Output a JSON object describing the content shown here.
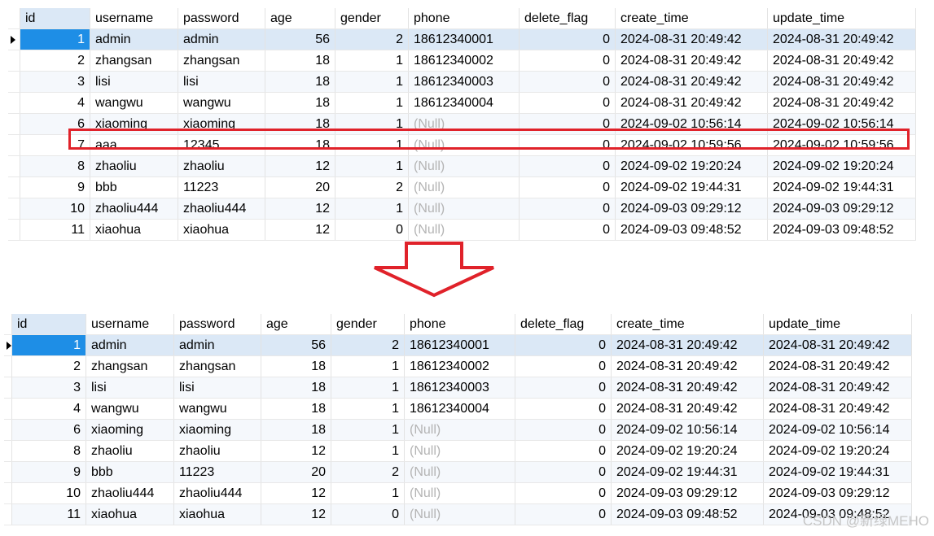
{
  "columns": [
    "id",
    "username",
    "password",
    "age",
    "gender",
    "phone",
    "delete_flag",
    "create_time",
    "update_time"
  ],
  "null_text": "(Null)",
  "before": {
    "rows": [
      [
        "1",
        "admin",
        "admin",
        "56",
        "2",
        "18612340001",
        "0",
        "2024-08-31 20:49:42",
        "2024-08-31 20:49:42"
      ],
      [
        "2",
        "zhangsan",
        "zhangsan",
        "18",
        "1",
        "18612340002",
        "0",
        "2024-08-31 20:49:42",
        "2024-08-31 20:49:42"
      ],
      [
        "3",
        "lisi",
        "lisi",
        "18",
        "1",
        "18612340003",
        "0",
        "2024-08-31 20:49:42",
        "2024-08-31 20:49:42"
      ],
      [
        "4",
        "wangwu",
        "wangwu",
        "18",
        "1",
        "18612340004",
        "0",
        "2024-08-31 20:49:42",
        "2024-08-31 20:49:42"
      ],
      [
        "6",
        "xiaoming",
        "xiaoming",
        "18",
        "1",
        null,
        "0",
        "2024-09-02 10:56:14",
        "2024-09-02 10:56:14"
      ],
      [
        "7",
        "aaa",
        "12345",
        "18",
        "1",
        null,
        "0",
        "2024-09-02 10:59:56",
        "2024-09-02 10:59:56"
      ],
      [
        "8",
        "zhaoliu",
        "zhaoliu",
        "12",
        "1",
        null,
        "0",
        "2024-09-02 19:20:24",
        "2024-09-02 19:20:24"
      ],
      [
        "9",
        "bbb",
        "11223",
        "20",
        "2",
        null,
        "0",
        "2024-09-02 19:44:31",
        "2024-09-02 19:44:31"
      ],
      [
        "10",
        "zhaoliu444",
        "zhaoliu444",
        "12",
        "1",
        null,
        "0",
        "2024-09-03 09:29:12",
        "2024-09-03 09:29:12"
      ],
      [
        "11",
        "xiaohua",
        "xiaohua",
        "12",
        "0",
        null,
        "0",
        "2024-09-03 09:48:52",
        "2024-09-03 09:48:52"
      ]
    ],
    "highlighted_row_id": "7"
  },
  "after": {
    "rows": [
      [
        "1",
        "admin",
        "admin",
        "56",
        "2",
        "18612340001",
        "0",
        "2024-08-31 20:49:42",
        "2024-08-31 20:49:42"
      ],
      [
        "2",
        "zhangsan",
        "zhangsan",
        "18",
        "1",
        "18612340002",
        "0",
        "2024-08-31 20:49:42",
        "2024-08-31 20:49:42"
      ],
      [
        "3",
        "lisi",
        "lisi",
        "18",
        "1",
        "18612340003",
        "0",
        "2024-08-31 20:49:42",
        "2024-08-31 20:49:42"
      ],
      [
        "4",
        "wangwu",
        "wangwu",
        "18",
        "1",
        "18612340004",
        "0",
        "2024-08-31 20:49:42",
        "2024-08-31 20:49:42"
      ],
      [
        "6",
        "xiaoming",
        "xiaoming",
        "18",
        "1",
        null,
        "0",
        "2024-09-02 10:56:14",
        "2024-09-02 10:56:14"
      ],
      [
        "8",
        "zhaoliu",
        "zhaoliu",
        "12",
        "1",
        null,
        "0",
        "2024-09-02 19:20:24",
        "2024-09-02 19:20:24"
      ],
      [
        "9",
        "bbb",
        "11223",
        "20",
        "2",
        null,
        "0",
        "2024-09-02 19:44:31",
        "2024-09-02 19:44:31"
      ],
      [
        "10",
        "zhaoliu444",
        "zhaoliu444",
        "12",
        "1",
        null,
        "0",
        "2024-09-03 09:29:12",
        "2024-09-03 09:29:12"
      ],
      [
        "11",
        "xiaohua",
        "xiaohua",
        "12",
        "0",
        null,
        "0",
        "2024-09-03 09:48:52",
        "2024-09-03 09:48:52"
      ]
    ]
  },
  "arrow_icon": "down-arrow-icon",
  "highlight_color": "#e0222a",
  "selection_color": "#1e8ee6",
  "watermark": "CSDN @新绿MEHO"
}
